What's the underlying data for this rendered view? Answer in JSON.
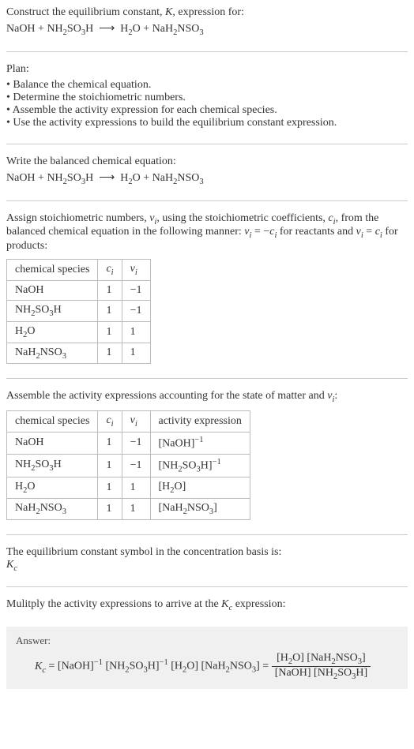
{
  "intro": {
    "line1": "Construct the equilibrium constant, K, expression for:",
    "equation": "NaOH + NH₂SO₃H ⟶ H₂O + NaH₂NSO₃"
  },
  "plan": {
    "heading": "Plan:",
    "items": [
      "Balance the chemical equation.",
      "Determine the stoichiometric numbers.",
      "Assemble the activity expression for each chemical species.",
      "Use the activity expressions to build the equilibrium constant expression."
    ]
  },
  "balanced": {
    "heading": "Write the balanced chemical equation:",
    "equation": "NaOH + NH₂SO₃H ⟶ H₂O + NaH₂NSO₃"
  },
  "stoich_assign": {
    "para_a": "Assign stoichiometric numbers, νᵢ, using the stoichiometric coefficients, cᵢ, from the balanced chemical equation in the following manner: νᵢ = −cᵢ for reactants and νᵢ = cᵢ for products:",
    "table": {
      "headers": [
        "chemical species",
        "cᵢ",
        "νᵢ"
      ],
      "rows": [
        [
          "NaOH",
          "1",
          "−1"
        ],
        [
          "NH₂SO₃H",
          "1",
          "−1"
        ],
        [
          "H₂O",
          "1",
          "1"
        ],
        [
          "NaH₂NSO₃",
          "1",
          "1"
        ]
      ]
    }
  },
  "activity": {
    "heading": "Assemble the activity expressions accounting for the state of matter and νᵢ:",
    "table": {
      "headers": [
        "chemical species",
        "cᵢ",
        "νᵢ",
        "activity expression"
      ],
      "rows": [
        [
          "NaOH",
          "1",
          "−1",
          "[NaOH]⁻¹"
        ],
        [
          "NH₂SO₃H",
          "1",
          "−1",
          "[NH₂SO₃H]⁻¹"
        ],
        [
          "H₂O",
          "1",
          "1",
          "[H₂O]"
        ],
        [
          "NaH₂NSO₃",
          "1",
          "1",
          "[NaH₂NSO₃]"
        ]
      ]
    }
  },
  "symbol": {
    "line1": "The equilibrium constant symbol in the concentration basis is:",
    "line2": "K_c"
  },
  "multiply": {
    "heading": "Mulitply the activity expressions to arrive at the K_c expression:"
  },
  "answer": {
    "label": "Answer:",
    "lhs": "K_c = [NaOH]⁻¹ [NH₂SO₃H]⁻¹ [H₂O] [NaH₂NSO₃] = ",
    "frac_num": "[H₂O] [NaH₂NSO₃]",
    "frac_den": "[NaOH] [NH₂SO₃H]"
  }
}
